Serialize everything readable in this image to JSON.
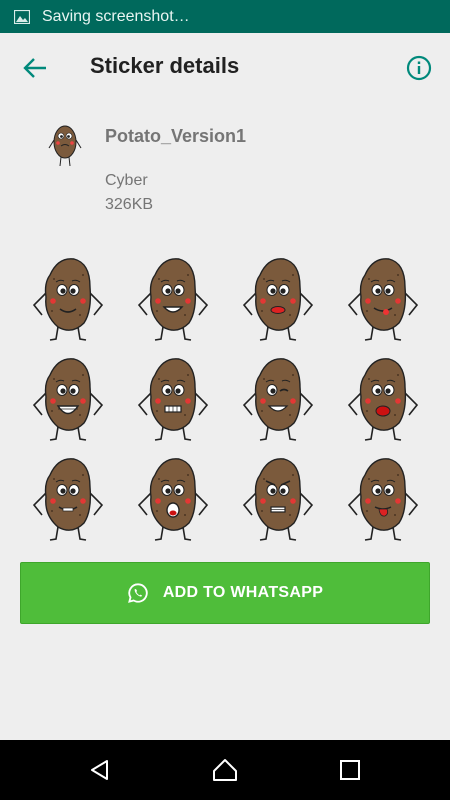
{
  "status_bar": {
    "notification": "Saving screenshot…",
    "icon": "image-icon"
  },
  "app_bar": {
    "title": "Sticker details",
    "back_icon": "arrow-back-icon",
    "info_icon": "info-icon"
  },
  "pack": {
    "name": "Potato_Version1",
    "publisher": "Cyber",
    "size": "326KB",
    "tray_icon": "potato-tray-icon"
  },
  "stickers": [
    {
      "expression": "smile"
    },
    {
      "expression": "grin"
    },
    {
      "expression": "lips"
    },
    {
      "expression": "tongue-smile"
    },
    {
      "expression": "big-grin"
    },
    {
      "expression": "teeth"
    },
    {
      "expression": "wink"
    },
    {
      "expression": "tongue-out"
    },
    {
      "expression": "teeth-smile"
    },
    {
      "expression": "shout"
    },
    {
      "expression": "angry"
    },
    {
      "expression": "raspberry"
    }
  ],
  "add_button": {
    "label": "ADD TO WHATSAPP",
    "icon": "whatsapp-icon"
  },
  "nav_bar": {
    "back": "back-triangle-icon",
    "home": "home-icon",
    "recents": "recents-square-icon"
  },
  "colors": {
    "status_bar": "#00695c",
    "accent": "#00897b",
    "add_button": "#4fbd3a",
    "potato": "#7b5a3c",
    "background": "#eeeeee"
  }
}
